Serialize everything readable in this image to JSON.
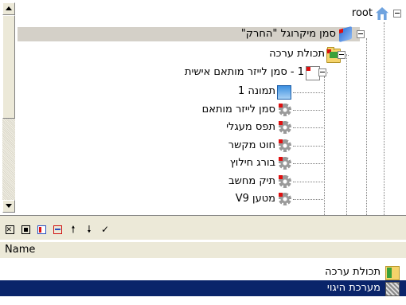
{
  "tree": {
    "nodes": [
      {
        "label": "root",
        "icon": "home-icon"
      },
      {
        "label": "סמן מיקרוגל \"החרק\"",
        "icon": "book-icon",
        "selected": true
      },
      {
        "label": "תכולת ערכה",
        "icon": "folder-icon"
      },
      {
        "label": "1 - סמן לייזר מותאם אישית",
        "icon": "page-icon"
      },
      {
        "label": "תמונה 1",
        "icon": "image-icon"
      },
      {
        "label": "סמן לייזר מותאם",
        "icon": "gear-icon"
      },
      {
        "label": "תפס מעגלי",
        "icon": "gear-icon"
      },
      {
        "label": "חוט מקשר",
        "icon": "gear-icon"
      },
      {
        "label": "בורג חילוץ",
        "icon": "gear-icon"
      },
      {
        "label": "תיק מחשב",
        "icon": "gear-icon"
      },
      {
        "label": "מטען V9",
        "icon": "gear-icon"
      }
    ]
  },
  "toolbar": {
    "buttons": [
      "delete-icon",
      "stop-icon",
      "properties-icon",
      "window-icon",
      "move-up-icon",
      "move-down-icon"
    ],
    "check_glyph": "✓",
    "up_glyph": "🠕",
    "down_glyph": "🠗"
  },
  "list": {
    "column_header": "Name",
    "rows": [
      {
        "label": "תכולת ערכה",
        "icon": "folder-icon"
      },
      {
        "label": "מערכת היגוי",
        "icon": "system-icon",
        "selected": true
      }
    ]
  }
}
